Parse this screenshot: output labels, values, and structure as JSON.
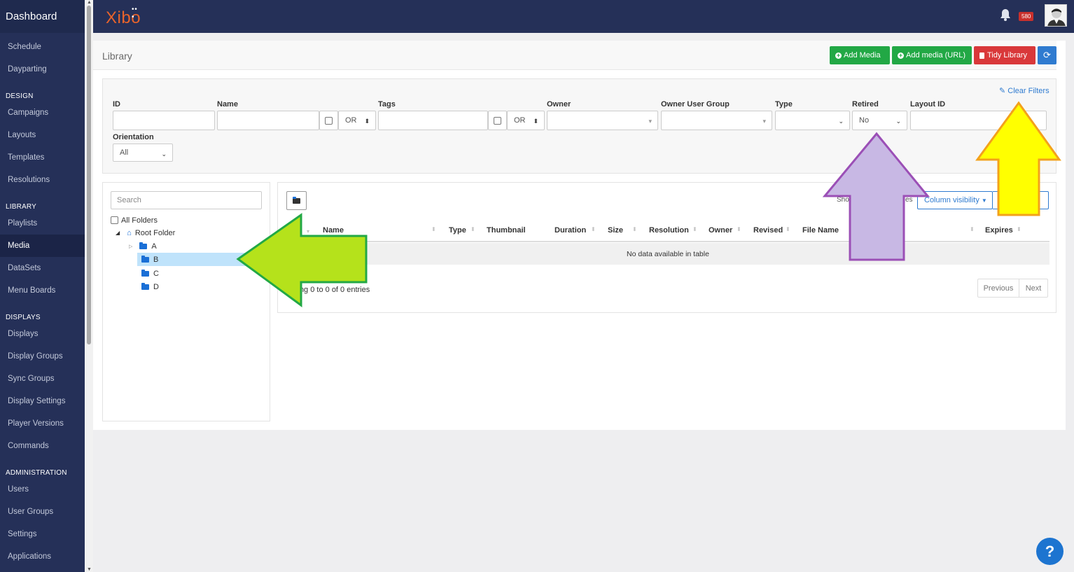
{
  "sidebar": {
    "brand": "Dashboard",
    "items_top": [
      "Schedule",
      "Dayparting"
    ],
    "sections": [
      {
        "title": "DESIGN",
        "items": [
          "Campaigns",
          "Layouts",
          "Templates",
          "Resolutions"
        ]
      },
      {
        "title": "LIBRARY",
        "items": [
          "Playlists",
          "Media",
          "DataSets",
          "Menu Boards"
        ]
      },
      {
        "title": "DISPLAYS",
        "items": [
          "Displays",
          "Display Groups",
          "Sync Groups",
          "Display Settings",
          "Player Versions",
          "Commands"
        ]
      },
      {
        "title": "ADMINISTRATION",
        "items": [
          "Users",
          "User Groups",
          "Settings",
          "Applications"
        ]
      }
    ],
    "active_item": "Media"
  },
  "topbar": {
    "logo": "Xibo",
    "notification_count": "580"
  },
  "library": {
    "title": "Library",
    "buttons": {
      "add_media": "Add Media",
      "add_media_url": "Add media (URL)",
      "tidy_library": "Tidy Library",
      "refresh_icon": "refresh-icon"
    }
  },
  "filters": {
    "clear_filters": "Clear Filters",
    "labels": {
      "id": "ID",
      "name": "Name",
      "tags": "Tags",
      "owner": "Owner",
      "owner_user_group": "Owner User Group",
      "type": "Type",
      "retired": "Retired",
      "layout_id": "Layout ID",
      "orientation": "Orientation"
    },
    "name_logic": "OR",
    "tags_logic": "OR",
    "retired_value": "No",
    "orientation_value": "All"
  },
  "tree": {
    "search_placeholder": "Search",
    "all_folders": "All Folders",
    "root": "Root Folder",
    "folders": [
      "A",
      "B",
      "C",
      "D"
    ],
    "selected": "B"
  },
  "table": {
    "column_visibility": "Column visibility",
    "show_fragment": "Sho",
    "show_fragment_end": "es",
    "headers": [
      "Name",
      "Type",
      "Thumbnail",
      "Duration",
      "Size",
      "Resolution",
      "Owner",
      "Revised",
      "File Name",
      "Expires"
    ],
    "empty_message": "No data available in table",
    "entries_info": "ving 0 to 0 of 0 entries",
    "pager": {
      "previous": "Previous",
      "next": "Next"
    }
  },
  "help": {
    "label": "?"
  },
  "colors": {
    "sidebar_bg": "#253058",
    "accent_green": "#22a845",
    "accent_red": "#d9383a",
    "accent_blue": "#2f7bd0",
    "arrow_green": "#b5e21b",
    "arrow_purple": "#c8b8e4",
    "arrow_yellow": "#ffff00"
  }
}
